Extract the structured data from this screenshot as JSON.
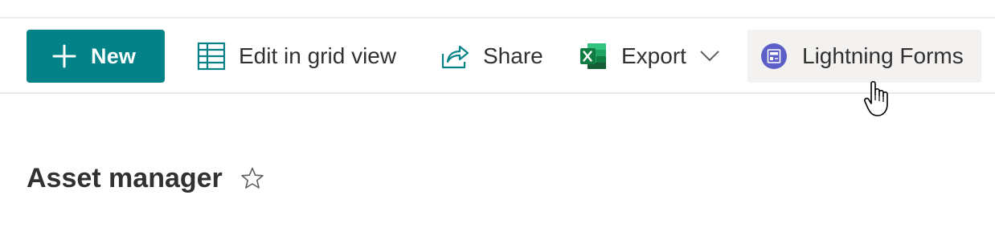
{
  "toolbar": {
    "new_label": "New",
    "edit_grid_label": "Edit in grid view",
    "share_label": "Share",
    "export_label": "Export",
    "lightning_forms_label": "Lightning Forms"
  },
  "page": {
    "title": "Asset manager"
  },
  "icons": {
    "new": "plus-icon",
    "edit_grid": "grid-icon",
    "share": "share-icon",
    "export": "excel-icon",
    "export_dropdown": "chevron-down-icon",
    "lightning_forms": "lightning-forms-icon",
    "favorite": "star-outline-icon",
    "cursor": "hand-pointer-cursor"
  },
  "colors": {
    "new_button_bg": "#038387",
    "accent_teal": "#038387",
    "excel_green": "#107c41",
    "lightning_purple": "#5b5fc7",
    "text": "#323130",
    "hover_bg": "#f3f2f1"
  }
}
